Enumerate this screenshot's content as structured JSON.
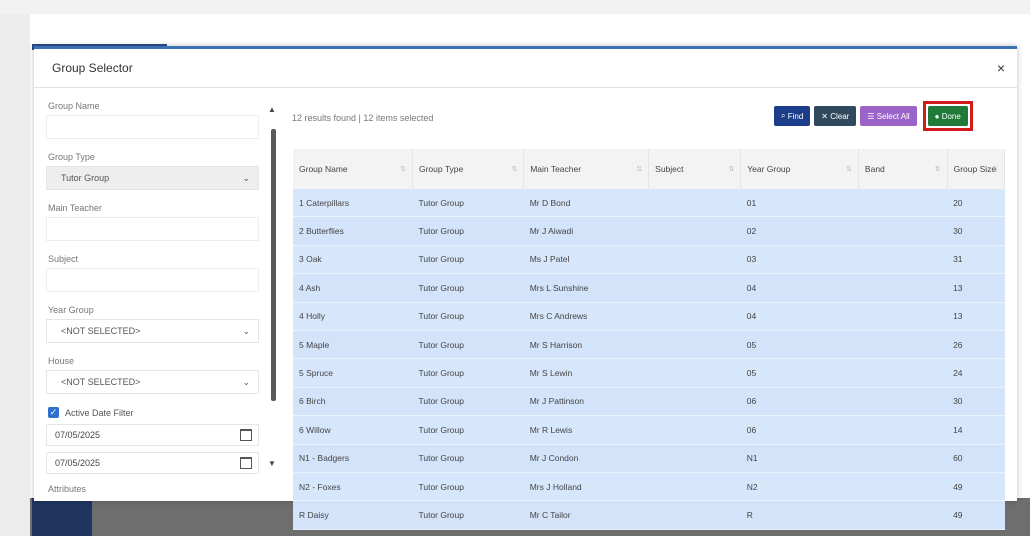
{
  "modal": {
    "title": "Group Selector",
    "close_label": "×"
  },
  "filters": {
    "group_name_label": "Group Name",
    "group_type_label": "Group Type",
    "group_type_value": "Tutor Group",
    "main_teacher_label": "Main Teacher",
    "subject_label": "Subject",
    "year_group_label": "Year Group",
    "year_group_value": "<NOT SELECTED>",
    "house_label": "House",
    "house_value": "<NOT SELECTED>",
    "active_date_filter_label": "Active Date Filter",
    "date_from": "07/05/2025",
    "date_to": "07/05/2025",
    "attributes_label": "Attributes"
  },
  "results": {
    "summary": "12 results found | 12 items selected"
  },
  "toolbar": {
    "find": "Find",
    "clear": "Clear",
    "select_all": "Select All",
    "done": "Done"
  },
  "table": {
    "headers": [
      "Group Name",
      "Group Type",
      "Main Teacher",
      "Subject",
      "Year Group",
      "Band",
      "Group Size"
    ],
    "rows": [
      [
        "1 Caterpillars",
        "Tutor Group",
        "Mr D Bond",
        "",
        "01",
        "",
        "20"
      ],
      [
        "2 Butterflies",
        "Tutor Group",
        "Mr J Aiwadi",
        "",
        "02",
        "",
        "30"
      ],
      [
        "3 Oak",
        "Tutor Group",
        "Ms J Patel",
        "",
        "03",
        "",
        "31"
      ],
      [
        "4 Ash",
        "Tutor Group",
        "Mrs L Sunshine",
        "",
        "04",
        "",
        "13"
      ],
      [
        "4 Holly",
        "Tutor Group",
        "Mrs C Andrews",
        "",
        "04",
        "",
        "13"
      ],
      [
        "5 Maple",
        "Tutor Group",
        "Mr S Harrison",
        "",
        "05",
        "",
        "26"
      ],
      [
        "5 Spruce",
        "Tutor Group",
        "Mr S Lewin",
        "",
        "05",
        "",
        "24"
      ],
      [
        "6 Birch",
        "Tutor Group",
        "Mr J Pattinson",
        "",
        "06",
        "",
        "30"
      ],
      [
        "6 Willow",
        "Tutor Group",
        "Mr R Lewis",
        "",
        "06",
        "",
        "14"
      ],
      [
        "N1 - Badgers",
        "Tutor Group",
        "Mr J Condon",
        "",
        "N1",
        "",
        "60"
      ],
      [
        "N2 - Foxes",
        "Tutor Group",
        "Mrs J Holland",
        "",
        "N2",
        "",
        "49"
      ],
      [
        "R Daisy",
        "Tutor Group",
        "Mr C Tailor",
        "",
        "R",
        "",
        "49"
      ]
    ]
  },
  "colors": {
    "accent": "#3b6fb6",
    "done": "#1f7a3a",
    "highlight": "#d21b1b",
    "row": "#d7e7fb"
  }
}
